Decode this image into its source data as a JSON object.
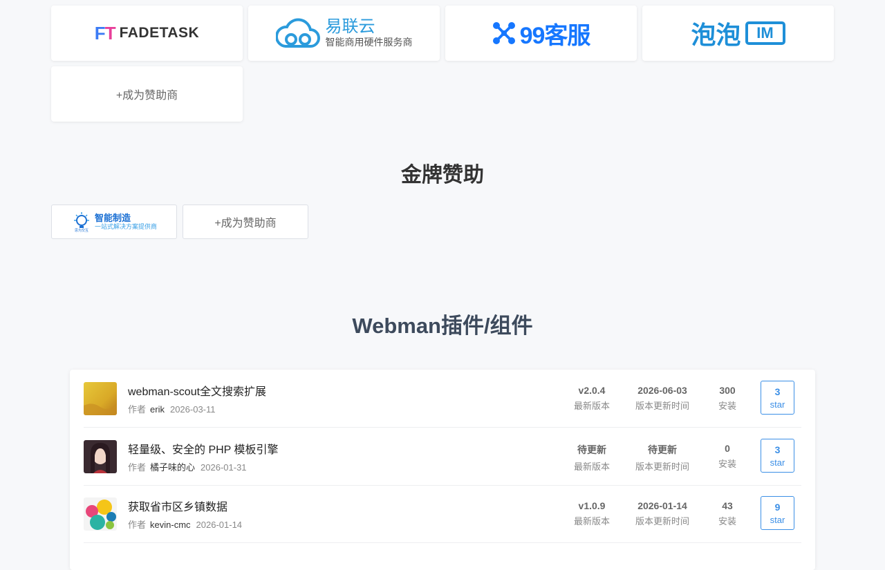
{
  "sponsors": {
    "fadetask": {
      "mark_f": "F",
      "mark_t": "T",
      "word": "FADETASK"
    },
    "yilianyun": {
      "title": "易联云",
      "subtitle": "智能商用硬件服务商"
    },
    "kefu99": {
      "text": "99客服"
    },
    "paopao": {
      "text": "泡泡",
      "badge": "IM"
    },
    "become": "+成为赞助商"
  },
  "gold": {
    "title": "金牌赞助",
    "card1": {
      "name": "智能制造",
      "tagline": "一站式解决方案提供商",
      "small": "思为交互"
    },
    "become": "+成为赞助商"
  },
  "plugins": {
    "title": "Webman插件/组件",
    "author_label": "作者",
    "version_label": "最新版本",
    "update_label": "版本更新时间",
    "install_label": "安装",
    "star_label": "star",
    "items": [
      {
        "name": "webman-scout全文搜索扩展",
        "author": "erik",
        "date": "2026-03-11",
        "version": "v2.0.4",
        "updated": "2026-06-03",
        "installs": "300",
        "stars": "3"
      },
      {
        "name": "轻量级、安全的 PHP 模板引擎",
        "author": "橘子味的心",
        "date": "2026-01-31",
        "version": "待更新",
        "updated": "待更新",
        "installs": "0",
        "stars": "3"
      },
      {
        "name": "获取省市区乡镇数据",
        "author": "kevin-cmc",
        "date": "2026-01-14",
        "version": "v1.0.9",
        "updated": "2026-01-14",
        "installs": "43",
        "stars": "9"
      }
    ]
  }
}
